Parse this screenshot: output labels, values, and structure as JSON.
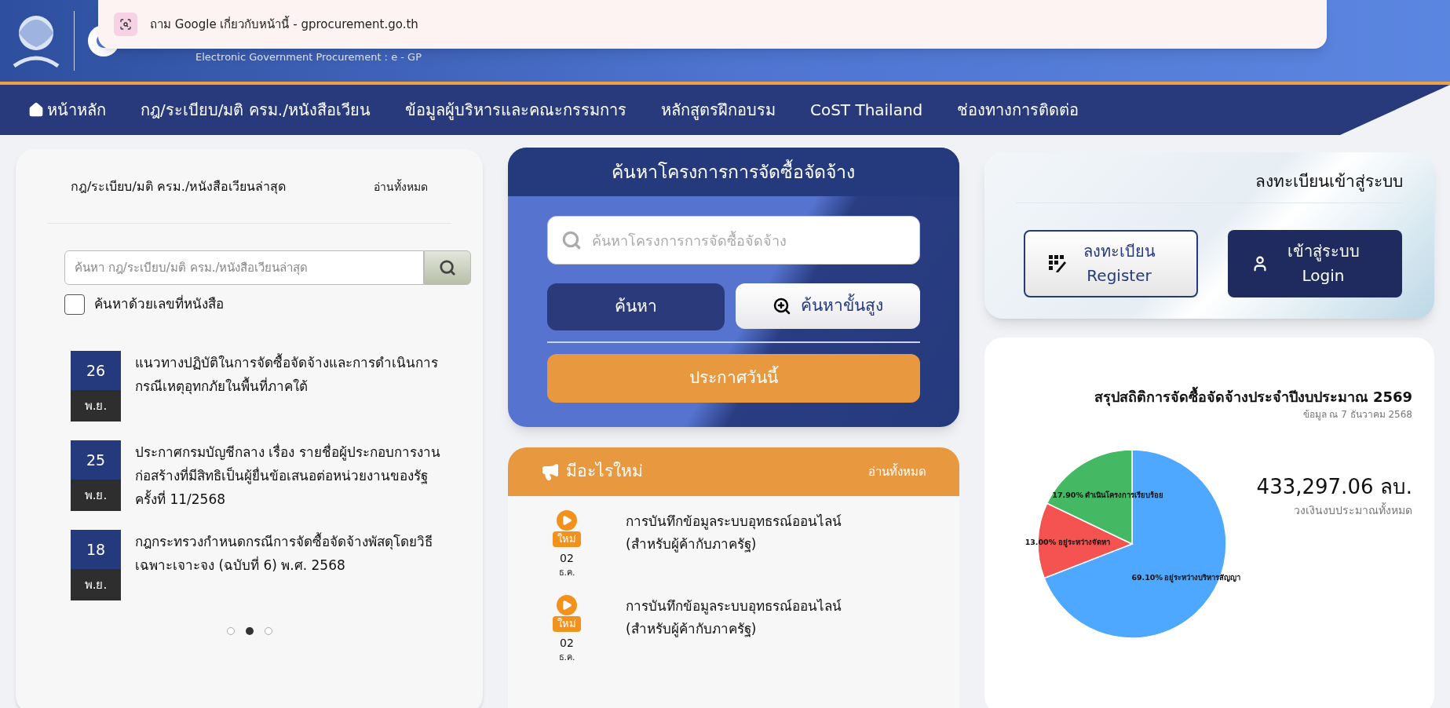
{
  "browser_popup": {
    "text": "ถาม Google เกี่ยวกับหน้านี้ - gprocurement.go.th"
  },
  "header": {
    "subtitle": "Electronic Government Procurement : e - GP"
  },
  "nav": [
    {
      "label": "หน้าหลัก",
      "kind": "home"
    },
    {
      "label": "กฎ/ระเบียบ/มติ ครม./หนังสือเวียน",
      "kind": "link"
    },
    {
      "label": "ข้อมูลผู้บริหารและคณะกรรมการ",
      "kind": "link"
    },
    {
      "label": "หลักสูตรฝึกอบรม",
      "kind": "link"
    },
    {
      "label": "CoST Thailand",
      "kind": "link"
    },
    {
      "label": "ช่องทางการติดต่อ",
      "kind": "link"
    }
  ],
  "regulations": {
    "title": "กฎ/ระเบียบ/มติ ครม./หนังสือเวียนล่าสุด",
    "read_all": "อ่านทั้งหมด",
    "search": {
      "placeholder": "ค้นหา กฎ/ระเบียบ/มติ ครม./หนังสือเวียนล่าสุด"
    },
    "checkbox": {
      "label": "ค้นหาด้วยเลขที่หนังสือ",
      "checked": false
    },
    "items": [
      {
        "day": "26",
        "month": "พ.ย.",
        "text": "แนวทางปฏิบัติในการจัดซื้อจัดจ้างและการดำเนินการกรณีเหตุอุทกภัยในพื้นที่ภาคใต้"
      },
      {
        "day": "25",
        "month": "พ.ย.",
        "text": "ประกาศกรมบัญชีกลาง เรื่อง รายชื่อผู้ประกอบการงานก่อสร้างที่มีสิทธิเป็นผู้ยื่นข้อเสนอต่อหน่วยงานของรัฐ ครั้งที่ 11/2568"
      },
      {
        "day": "18",
        "month": "พ.ย.",
        "text": "กฎกระทรวงกำหนดกรณีการจัดซื้อจัดจ้างพัสดุโดยวิธีเฉพาะเจาะจง (ฉบับที่ 6) พ.ศ. 2568"
      }
    ],
    "pager": [
      {
        "selected": false
      },
      {
        "selected": true
      },
      {
        "selected": false
      }
    ]
  },
  "project_search": {
    "title": "ค้นหาโครงการการจัดซื้อจัดจ้าง",
    "search": {
      "placeholder": "ค้นหาโครงการการจัดซื้อจัดจ้าง"
    },
    "search_button": "ค้นหา",
    "advanced_button": "ค้นหาขั้นสูง",
    "today_button": "ประกาศวันนี้"
  },
  "whats_new": {
    "title": "มีอะไรใหม่",
    "read_all": "อ่านทั้งหมด",
    "items": [
      {
        "badge": "ใหม่",
        "day": "02",
        "month": "ธ.ค.",
        "text": "การบันทึกข้อมูลระบบอุทธรณ์ออนไลน์\n(สำหรับผู้ค้ากับภาครัฐ)"
      },
      {
        "badge": "ใหม่",
        "day": "02",
        "month": "ธ.ค.",
        "text": "การบันทึกข้อมูลระบบอุทธรณ์ออนไลน์\n(สำหรับผู้ค้ากับภาครัฐ)"
      }
    ]
  },
  "login": {
    "title": "ลงทะเบียนเข้าสู่ระบบ",
    "buttons": [
      {
        "kind": "register",
        "label_th": "ลงทะเบียน",
        "label_en": "Register"
      },
      {
        "kind": "login",
        "label_th": "เข้าสู่ระบบ",
        "label_en": "Login"
      }
    ]
  },
  "stats": {
    "title": "สรุปสถิติการจัดซื้อจัดจ้างประจำปีงบประมาณ 2569",
    "subtitle": "ข้อมูล ณ 7 ธันวาคม 2568",
    "total": "433,297.06 ลบ.",
    "total_label": "วงเงินงบประมาณทั้งหมด",
    "chart_data": {
      "type": "pie",
      "categories": [
        "อยู่ระหว่างบริหารสัญญา",
        "อยู่ระหว่างจัดหา",
        "ดำเนินโครงการเรียบร้อย"
      ],
      "values": [
        69.1,
        13.0,
        17.9
      ],
      "colors": [
        "#4fa8ff",
        "#f55252",
        "#45b863"
      ],
      "value_labels": [
        "69.10%",
        "13.00%",
        "17.90%"
      ]
    }
  }
}
